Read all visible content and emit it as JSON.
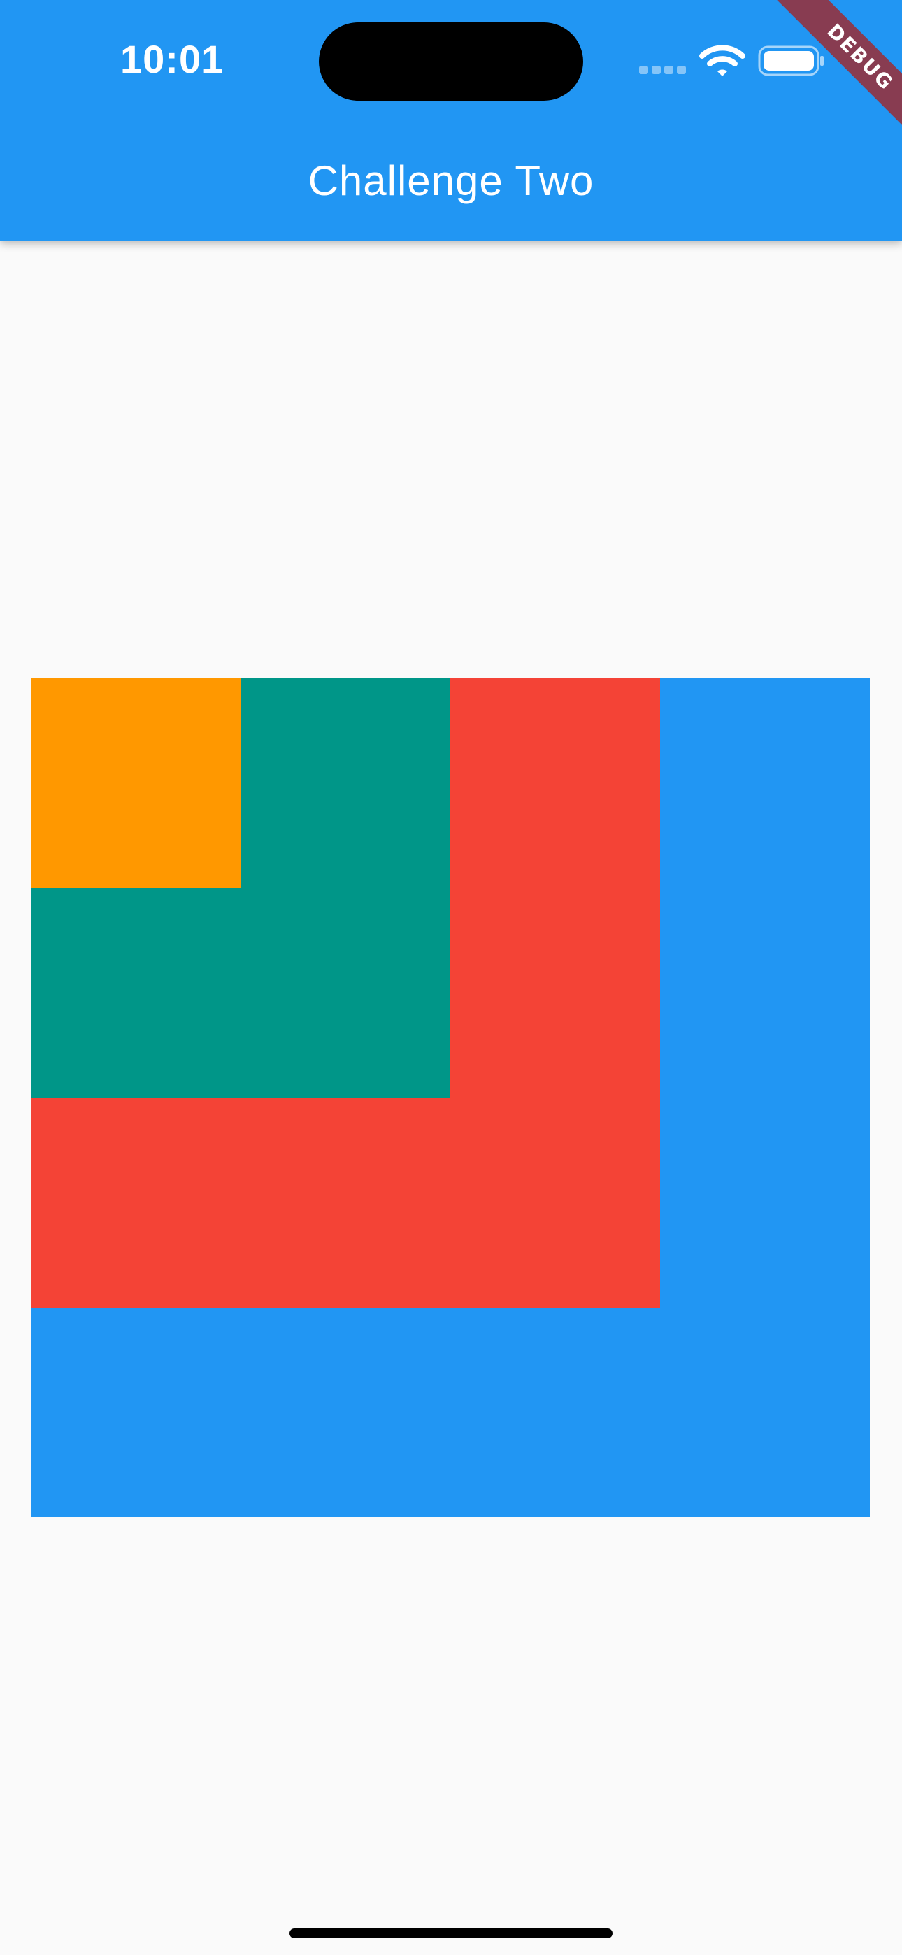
{
  "status_bar": {
    "time": "10:01"
  },
  "app_bar": {
    "title": "Challenge Two",
    "color": "#2196f3"
  },
  "debug_banner": {
    "label": "DEBUG",
    "color": "#883c51"
  },
  "boxes": [
    {
      "name": "blue",
      "color": "#2196f3"
    },
    {
      "name": "red",
      "color": "#f44336"
    },
    {
      "name": "teal",
      "color": "#009688"
    },
    {
      "name": "orange",
      "color": "#ff9800"
    }
  ],
  "icons": [
    "signal-icon",
    "wifi-icon",
    "battery-icon"
  ]
}
